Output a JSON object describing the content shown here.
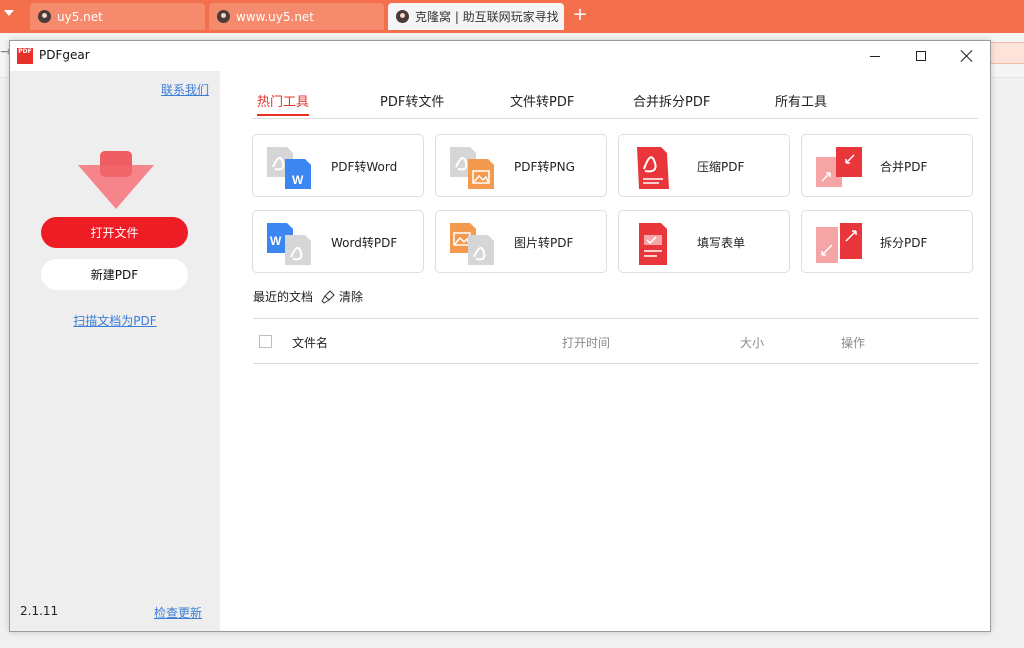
{
  "browser": {
    "tabs": [
      {
        "label": "uy5.net"
      },
      {
        "label": "www.uy5.net"
      },
      {
        "label": "克隆窝 | 助互联网玩家寻找"
      }
    ],
    "add_tab_label": "+",
    "back_glyph": "→"
  },
  "window": {
    "title": "PDFgear",
    "logo_text": "PDF"
  },
  "sidebar": {
    "contact_label": "联系我们",
    "open_file_label": "打开文件",
    "new_pdf_label": "新建PDF",
    "scan_label": "扫描文档为PDF",
    "version": "2.1.11",
    "check_update_label": "检查更新"
  },
  "tabs": [
    {
      "label": "热门工具",
      "active": true
    },
    {
      "label": "PDF转文件",
      "active": false
    },
    {
      "label": "文件转PDF",
      "active": false
    },
    {
      "label": "合并拆分PDF",
      "active": false
    },
    {
      "label": "所有工具",
      "active": false
    }
  ],
  "tools": [
    {
      "label": "PDF转Word",
      "icon": "pdf-to-word-icon"
    },
    {
      "label": "PDF转PNG",
      "icon": "pdf-to-png-icon"
    },
    {
      "label": "压缩PDF",
      "icon": "compress-pdf-icon"
    },
    {
      "label": "合并PDF",
      "icon": "merge-pdf-icon"
    },
    {
      "label": "Word转PDF",
      "icon": "word-to-pdf-icon"
    },
    {
      "label": "图片转PDF",
      "icon": "image-to-pdf-icon"
    },
    {
      "label": "填写表单",
      "icon": "fill-form-icon"
    },
    {
      "label": "拆分PDF",
      "icon": "split-pdf-icon"
    }
  ],
  "recent": {
    "title": "最近的文档",
    "clear_label": "清除",
    "columns": {
      "name": "文件名",
      "open_time": "打开时间",
      "size": "大小",
      "actions": "操作"
    }
  },
  "colors": {
    "brand_red": "#e8302a",
    "primary_button": "#ee1c25",
    "link_blue": "#3b7ed8",
    "browser_accent": "#f4704c"
  }
}
